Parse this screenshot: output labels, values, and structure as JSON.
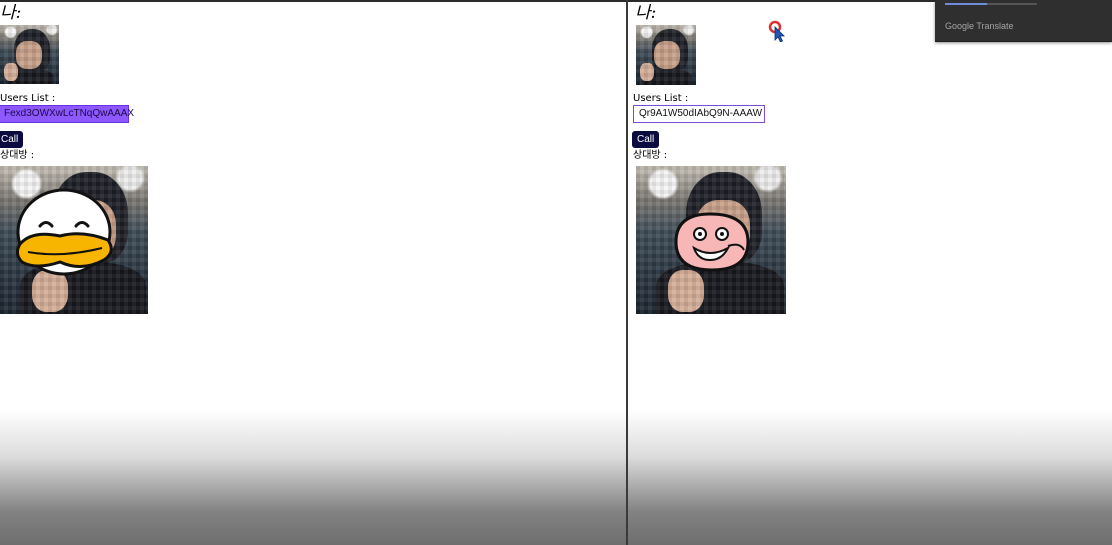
{
  "left": {
    "me_label": "나:",
    "users_list_label": "Users List :",
    "user_id": "Fexd3OWXwLcTNqQwAAAX",
    "call_label": "Call",
    "peer_label": "상대방 :",
    "peer_sticker": "duck-character-face"
  },
  "right": {
    "me_label": "나:",
    "users_list_label": "Users List :",
    "user_id": "Qr9A1W50dIAbQ9N-AAAW",
    "call_label": "Call",
    "peer_label": "상대방 :",
    "peer_sticker": "peach-character-face"
  },
  "overlay": {
    "translate_label": "Google Translate"
  },
  "colors": {
    "selected_user_bg": "#8d58ff",
    "call_button_bg": "#0b0b40",
    "user_box_border": "#7e4bd6"
  }
}
